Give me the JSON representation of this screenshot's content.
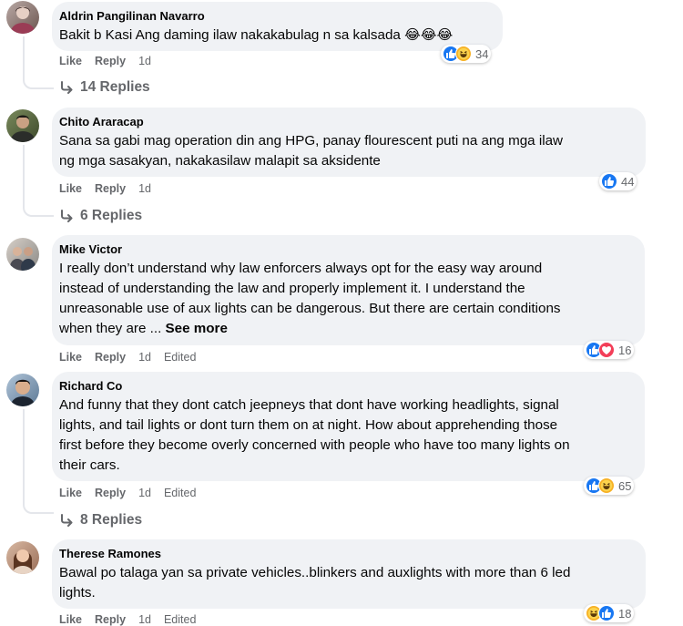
{
  "comments": [
    {
      "author": "Aldrin Pangilinan Navarro",
      "text": "Bakit b Kasi Ang daming ilaw nakakabulag n sa kalsada 😂😂😂",
      "reaction_count": "34",
      "reactions": [
        "like-icon",
        "haha-icon"
      ],
      "actions": {
        "like": "Like",
        "reply": "Reply",
        "time": "1d"
      },
      "replies": "14 Replies"
    },
    {
      "author": "Chito Araracap",
      "text_lines": [
        "Sana sa gabi mag operation din ang HPG, panay flourescent puti na ang mga ilaw",
        "ng mga sasakyan, nakakasilaw malapit sa aksidente"
      ],
      "reaction_count": "44",
      "reactions": [
        "like-icon"
      ],
      "actions": {
        "like": "Like",
        "reply": "Reply",
        "time": "1d"
      },
      "replies": "6 Replies"
    },
    {
      "author": "Mike Victor",
      "text_lines": [
        "I really don’t understand why law enforcers always opt for the easy way around",
        "instead of understanding the law and properly implement it. I understand the",
        "unreasonable use of aux lights can be dangerous. But there are certain conditions",
        "when they are ..."
      ],
      "see_more": "See more",
      "reaction_count": "16",
      "reactions": [
        "like-icon",
        "love-icon"
      ],
      "actions": {
        "like": "Like",
        "reply": "Reply",
        "time": "1d",
        "edited": "Edited"
      }
    },
    {
      "author": "Richard Co",
      "text_lines": [
        "And funny that they dont catch jeepneys that dont have working headlights, signal",
        "lights, and tail lights or dont turn them on at night. How about apprehending those",
        "first before they become overly concerned with people who have too many lights on",
        "their cars."
      ],
      "reaction_count": "65",
      "reactions": [
        "like-icon",
        "haha-icon"
      ],
      "actions": {
        "like": "Like",
        "reply": "Reply",
        "time": "1d",
        "edited": "Edited"
      },
      "replies": "8 Replies"
    },
    {
      "author": "Therese Ramones",
      "text_lines": [
        "Bawal po talaga yan sa private vehicles..blinkers and auxlights with more than 6 led",
        "lights."
      ],
      "reaction_count": "18",
      "reactions": [
        "haha-icon",
        "like-icon"
      ],
      "actions": {
        "like": "Like",
        "reply": "Reply",
        "time": "1d",
        "edited": "Edited"
      }
    }
  ]
}
